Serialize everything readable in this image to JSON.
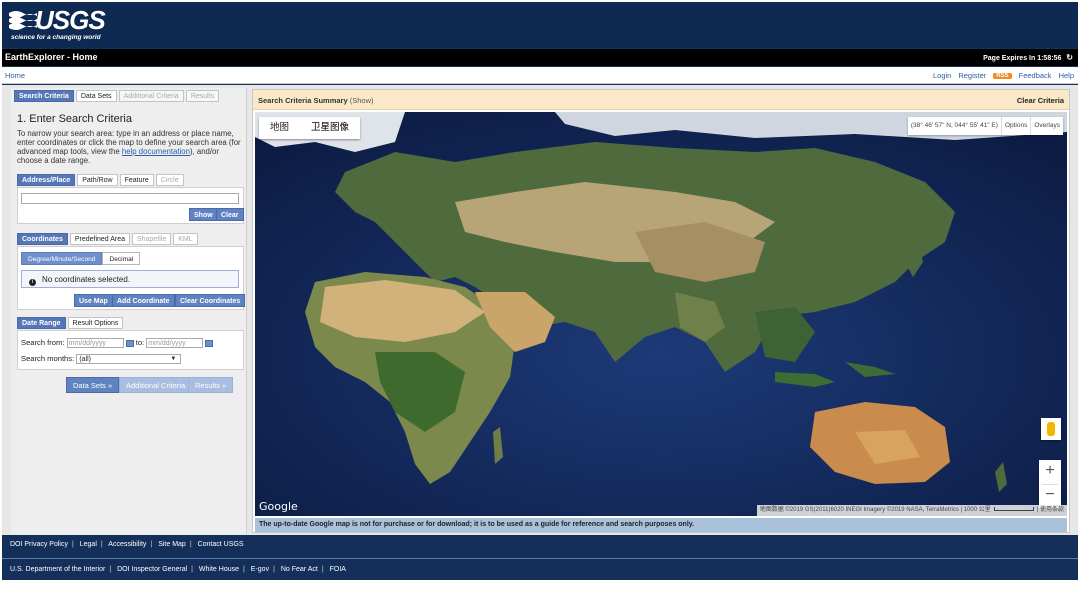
{
  "brand": {
    "logo_text": "USGS",
    "tagline": "science for a changing world"
  },
  "titlebar": {
    "title": "EarthExplorer - Home",
    "expires": "Page Expires In 1:58:56",
    "refresh_icon": "refresh-icon"
  },
  "nav": {
    "home": "Home",
    "right": [
      "Login",
      "Register",
      "RSS",
      "Feedback",
      "Help"
    ]
  },
  "tabs": [
    "Search Criteria",
    "Data Sets",
    "Additional Criteria",
    "Results"
  ],
  "search": {
    "heading": "1. Enter Search Criteria",
    "intro_a": "To narrow your search area: type in an address or place name, enter coordinates or click the map to define your search area (for advanced map tools, view the ",
    "intro_link": "help documentation",
    "intro_b": "), and/or choose a date range."
  },
  "address": {
    "tabs": [
      "Address/Place",
      "Path/Row",
      "Feature",
      "Circle"
    ],
    "input_value": "",
    "show": "Show",
    "clear": "Clear"
  },
  "coordinates": {
    "tabs": [
      "Coordinates",
      "Predefined Area",
      "Shapefile",
      "KML"
    ],
    "modes": [
      "Degree/Minute/Second",
      "Decimal"
    ],
    "notice": "No coordinates selected.",
    "use_map": "Use Map",
    "add": "Add Coordinate",
    "clear": "Clear Coordinates"
  },
  "dates": {
    "tabs": [
      "Date Range",
      "Result Options"
    ],
    "from_label": "Search from:",
    "from_placeholder": "mm/dd/yyyy",
    "to_label": "to:",
    "to_placeholder": "mm/dd/yyyy",
    "months_label": "Search months:",
    "months_value": "(all)"
  },
  "bottom_buttons": [
    "Data Sets »",
    "Additional Criteria »",
    "Results »"
  ],
  "map": {
    "summary_label": "Search Criteria Summary",
    "summary_toggle": "(Show)",
    "clear_criteria": "Clear Criteria",
    "type_map": "地图",
    "type_satellite": "卫星图像",
    "coords": "(38° 46' 57\" N, 044° 55' 41\" E)",
    "options": "Options",
    "overlays": "Overlays",
    "zoom_in": "+",
    "zoom_out": "−",
    "google": "Google",
    "attribution": "地图数据 ©2019 GS(2011)6020 INEGI Imagery ©2019 NASA, TerraMetrics",
    "scale": "1000 公里",
    "terms": "使用条款",
    "disclaimer": "The up-to-date Google map is not for purchase or for download; it is to be used as a guide for reference and search purposes only."
  },
  "footer": {
    "row1": [
      "DOI Privacy Policy",
      "Legal",
      "Accessibility",
      "Site Map",
      "Contact USGS"
    ],
    "row2": [
      "U.S. Department of the Interior",
      "DOI Inspector General",
      "White House",
      "E-gov",
      "No Fear Act",
      "FOIA"
    ]
  }
}
